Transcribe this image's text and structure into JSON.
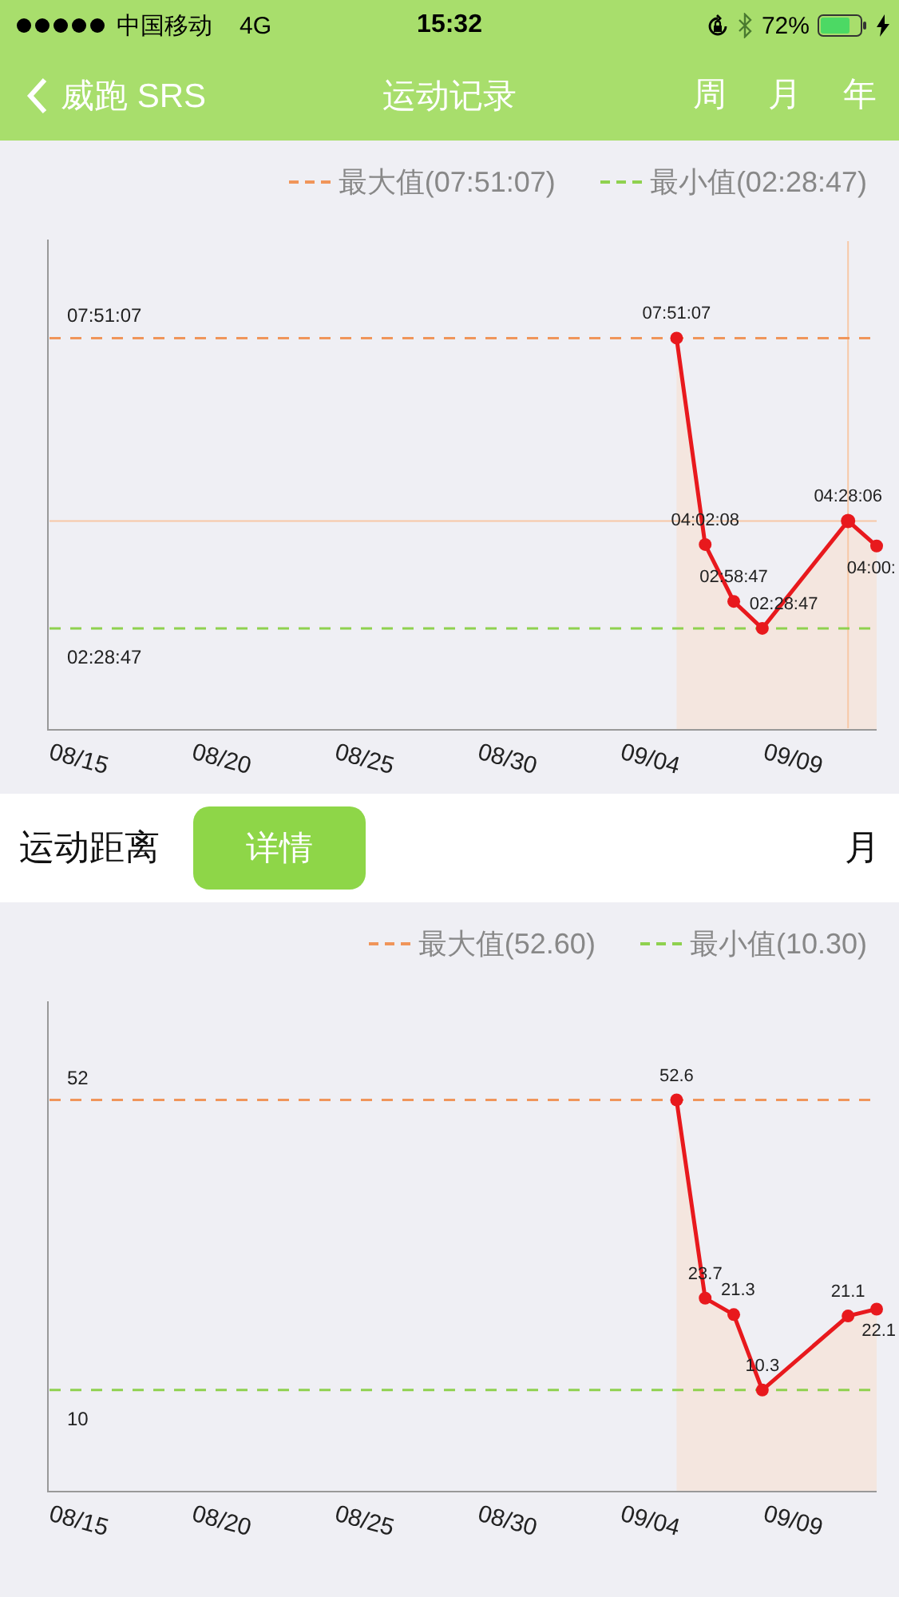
{
  "status_bar": {
    "carrier": "中国移动",
    "network": "4G",
    "time": "15:32",
    "battery": "72%"
  },
  "nav": {
    "back": "威跑 SRS",
    "title": "运动记录",
    "tabs": [
      {
        "label": "周",
        "selected": false
      },
      {
        "label": "月",
        "selected": false
      },
      {
        "label": "年",
        "selected": false
      }
    ]
  },
  "charts": [
    {
      "legend": [
        {
          "label": "最大值(07:51:07)",
          "color": "#f0955a"
        },
        {
          "label": "最小值(02:28:47)",
          "color": "#8fd14f"
        }
      ],
      "max_label": "07:51:07",
      "min_label": "02:28:47",
      "points": [
        {
          "label": "07:51:07",
          "selected": false
        },
        {
          "label": "04:02:08",
          "selected": false
        },
        {
          "label": "02:58:47",
          "selected": false
        },
        {
          "label": "02:28:47",
          "selected": false
        },
        {
          "label": "04:28:06",
          "selected": true
        },
        {
          "label": "04:00:",
          "selected": false
        }
      ],
      "axis_labels": [
        "08/15",
        "08/20",
        "08/25",
        "08/30",
        "09/04",
        "09/09"
      ]
    },
    {
      "section": {
        "title": "运动距离",
        "button": "详情",
        "period": "月"
      },
      "legend": [
        {
          "label": "最大值(52.60)",
          "color": "#f0955a"
        },
        {
          "label": "最小值(10.30)",
          "color": "#8fd14f"
        }
      ],
      "max_label": "52",
      "min_label": "10",
      "chart_data": {
        "type": "line",
        "data_labels": true,
        "categories": [
          "08/15",
          null,
          null,
          null,
          null,
          "08/20",
          null,
          null,
          null,
          null,
          "08/25",
          null,
          null,
          null,
          null,
          "08/30",
          null,
          null,
          null,
          null,
          "09/04",
          null,
          null,
          null,
          null,
          "09/09",
          null,
          null,
          null,
          null
        ],
        "series": [
          {
            "color": "#e8191d",
            "marker": "circle",
            "values": [
              null,
              null,
              null,
              null,
              null,
              null,
              null,
              null,
              null,
              null,
              null,
              null,
              null,
              null,
              null,
              null,
              null,
              null,
              null,
              null,
              null,
              null,
              52.6,
              23.7,
              21.3,
              10.3,
              null,
              null,
              21.1,
              22.1
            ]
          }
        ],
        "ref_lines": [
          {
            "axis": "y",
            "value": 52.6,
            "color": "#f0955a"
          },
          {
            "axis": "y",
            "value": 10.3,
            "color": "#8fd14f"
          }
        ]
      }
    }
  ]
}
